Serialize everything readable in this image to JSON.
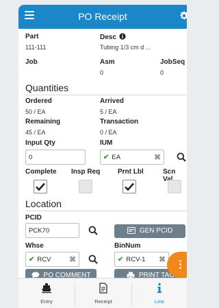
{
  "header": {
    "title": "PO Receipt",
    "menu_icon": "hamburger-icon",
    "settings_icon": "gear-icon",
    "color": "#1b87c9"
  },
  "details": {
    "part_label": "Part",
    "part_value": "111-111",
    "desc_label": "Desc",
    "desc_value": "Tubing 1/3 cm d ...",
    "job_label": "Job",
    "job_value": "",
    "asm_label": "Asm",
    "asm_value": "0",
    "jobseq_label": "JobSeq",
    "jobseq_value": "0"
  },
  "quantities": {
    "section_label": "Quantities",
    "ordered_label": "Ordered",
    "ordered_value": "50 / EA",
    "arrived_label": "Arrived",
    "arrived_value": "5 / EA",
    "remaining_label": "Remaining",
    "remaining_value": "45 / EA",
    "transaction_label": "Transaction",
    "transaction_value": "0 / EA",
    "input_qty_label": "Input Qty",
    "input_qty_value": "0",
    "ium_label": "IUM",
    "ium_value": "EA",
    "complete_label": "Complete",
    "complete_checked": true,
    "insp_req_label": "Insp Req",
    "insp_req_checked": false,
    "prnt_lbl_label": "Prnt Lbl",
    "prnt_lbl_checked": true,
    "scn_val_label": "Scn Val",
    "scn_val_checked": false
  },
  "location": {
    "section_label": "Location",
    "pcid_label": "PCID",
    "pcid_value": "PCK70",
    "gen_pcid_label": "GEN PCID",
    "whse_label": "Whse",
    "whse_value": "RCV",
    "binnum_label": "BinNum",
    "binnum_value": "RCV-1",
    "po_comment_label": "PO COMMENT",
    "print_tag_label": "PRINT TAG"
  },
  "fab_icon": "more-vertical-icon",
  "tabs": [
    {
      "label": "Entry",
      "icon": "ship-icon",
      "active": false
    },
    {
      "label": "Receipt",
      "icon": "receipt-icon",
      "active": false
    },
    {
      "label": "Line",
      "icon": "info-icon",
      "active": true
    }
  ],
  "colors": {
    "accent": "#1b87c9",
    "button": "#6e7f8c",
    "fab": "#f0881c",
    "valid": "#3aa03a"
  }
}
